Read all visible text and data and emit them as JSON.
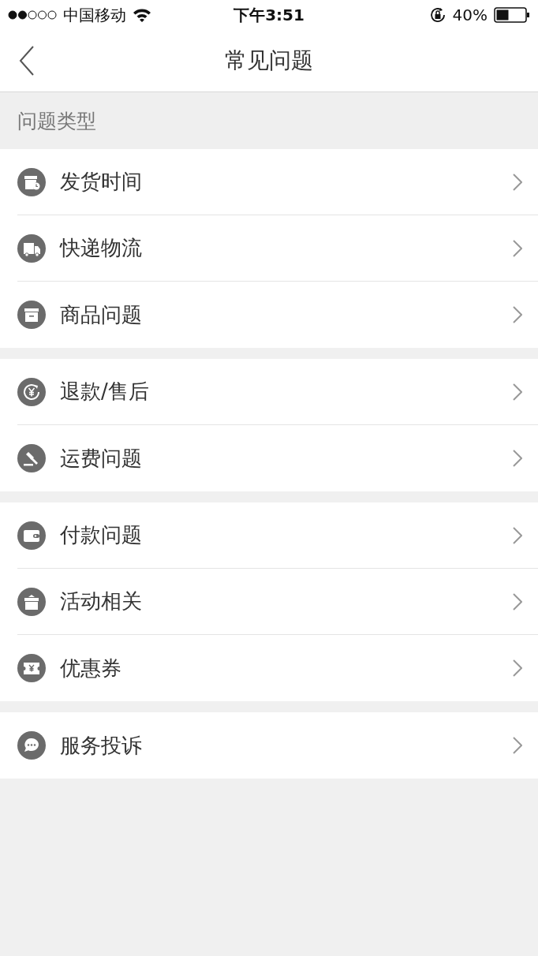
{
  "status_bar": {
    "carrier": "中国移动",
    "time": "下午3:51",
    "battery_percent": "40%"
  },
  "nav": {
    "title": "常见问题"
  },
  "section_header": "问题类型",
  "groups": [
    {
      "items": [
        {
          "label": "发货时间",
          "kind": "shipping"
        },
        {
          "label": "快递物流",
          "kind": "delivery"
        },
        {
          "label": "商品问题",
          "kind": "goods"
        }
      ]
    },
    {
      "items": [
        {
          "label": "退款/售后",
          "kind": "refund"
        },
        {
          "label": "运费问题",
          "kind": "fee"
        }
      ]
    },
    {
      "items": [
        {
          "label": "付款问题",
          "kind": "payment"
        },
        {
          "label": "活动相关",
          "kind": "event"
        },
        {
          "label": "优惠券",
          "kind": "coupon"
        }
      ]
    },
    {
      "items": [
        {
          "label": "服务投诉",
          "kind": "complaint"
        }
      ]
    }
  ]
}
